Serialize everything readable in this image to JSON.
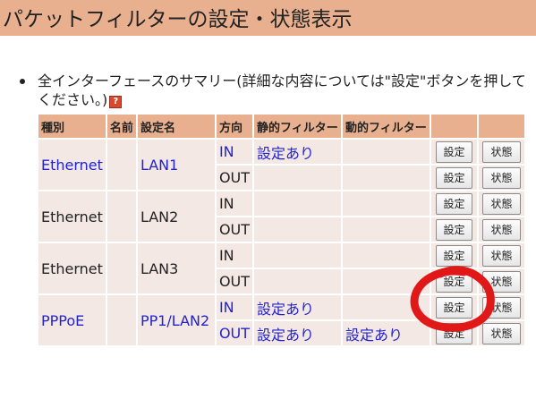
{
  "header": {
    "title": "パケットフィルターの設定・状態表示"
  },
  "summary": {
    "text": "全インターフェースのサマリー(詳細な内容については\"設定\"ボタンを押してください。)",
    "help_glyph": "?"
  },
  "table": {
    "headers": {
      "type": "種別",
      "name": "名前",
      "setting_name": "設定名",
      "direction": "方向",
      "static_filter": "静的フィルター",
      "dynamic_filter": "動的フィルター"
    },
    "groups": [
      {
        "type": "Ethernet",
        "name": "",
        "setting_name": "LAN1",
        "link": true,
        "rows": [
          {
            "direction": "IN",
            "static": "設定あり",
            "dynamic": "",
            "direction_link": true
          },
          {
            "direction": "OUT",
            "static": "",
            "dynamic": "",
            "direction_link": false
          }
        ]
      },
      {
        "type": "Ethernet",
        "name": "",
        "setting_name": "LAN2",
        "link": false,
        "rows": [
          {
            "direction": "IN",
            "static": "",
            "dynamic": "",
            "direction_link": false
          },
          {
            "direction": "OUT",
            "static": "",
            "dynamic": "",
            "direction_link": false
          }
        ]
      },
      {
        "type": "Ethernet",
        "name": "",
        "setting_name": "LAN3",
        "link": false,
        "rows": [
          {
            "direction": "IN",
            "static": "",
            "dynamic": "",
            "direction_link": false
          },
          {
            "direction": "OUT",
            "static": "",
            "dynamic": "",
            "direction_link": false
          }
        ]
      },
      {
        "type": "PPPoE",
        "name": "",
        "setting_name": "PP1/LAN2",
        "link": true,
        "rows": [
          {
            "direction": "IN",
            "static": "設定あり",
            "dynamic": "",
            "direction_link": true
          },
          {
            "direction": "OUT",
            "static": "設定あり",
            "dynamic": "設定あり",
            "direction_link": true
          }
        ]
      }
    ],
    "button_set_label": "設定",
    "button_status_label": "状態"
  },
  "colors": {
    "header_bg": "#e9b08f",
    "row_bg": "#f3e8e4",
    "link_blue": "#2323cc",
    "annotation_red": "#e01818"
  }
}
